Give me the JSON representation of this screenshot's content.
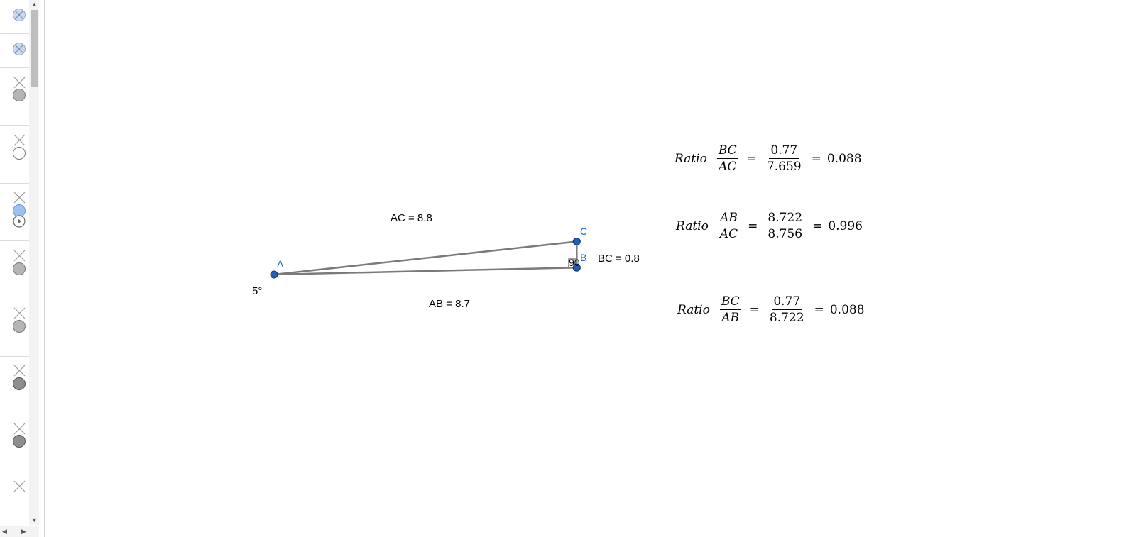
{
  "algebra_panel": {
    "rows": [
      {
        "icon": "hidden-visibility-icon"
      },
      {
        "icon": "hidden-visibility-icon"
      },
      {
        "icon": "gray-dot-icon"
      },
      {
        "icon": "white-dot-icon"
      },
      {
        "icon": "blue-dot-icon",
        "extra_icon": "play-icon"
      },
      {
        "icon": "gray-dot-icon"
      },
      {
        "icon": "gray-dot-icon"
      },
      {
        "icon": "dark-gray-dot-icon"
      },
      {
        "icon": "dark-gray-dot-icon"
      },
      {
        "icon": "close-icon"
      }
    ]
  },
  "figure": {
    "points": [
      {
        "name": "A",
        "x": 0,
        "y": 0
      },
      {
        "name": "B",
        "x": 8.7,
        "y": 0.2
      },
      {
        "name": "C",
        "x": 8.7,
        "y": 0.95
      }
    ],
    "labels": {
      "ac": "AC = 8.8",
      "ab": "AB = 8.7",
      "bc": "BC = 0.8",
      "angle_a": "5°",
      "angle_b": "90"
    }
  },
  "ratios": [
    {
      "word": "Ratio",
      "num": "BC",
      "den": "AC",
      "vnum": "0.77",
      "vden": "7.659",
      "value": "0.088"
    },
    {
      "word": "Ratio",
      "num": "AB",
      "den": "AC",
      "vnum": "8.722",
      "vden": "8.756",
      "value": "0.996"
    },
    {
      "word": "Ratio",
      "num": "BC",
      "den": "AB",
      "vnum": "0.77",
      "vden": "8.722",
      "value": "0.088"
    }
  ],
  "colors": {
    "point": "#1f5fb4",
    "segment": "#7a7a7a",
    "label": "#1a62b8"
  }
}
